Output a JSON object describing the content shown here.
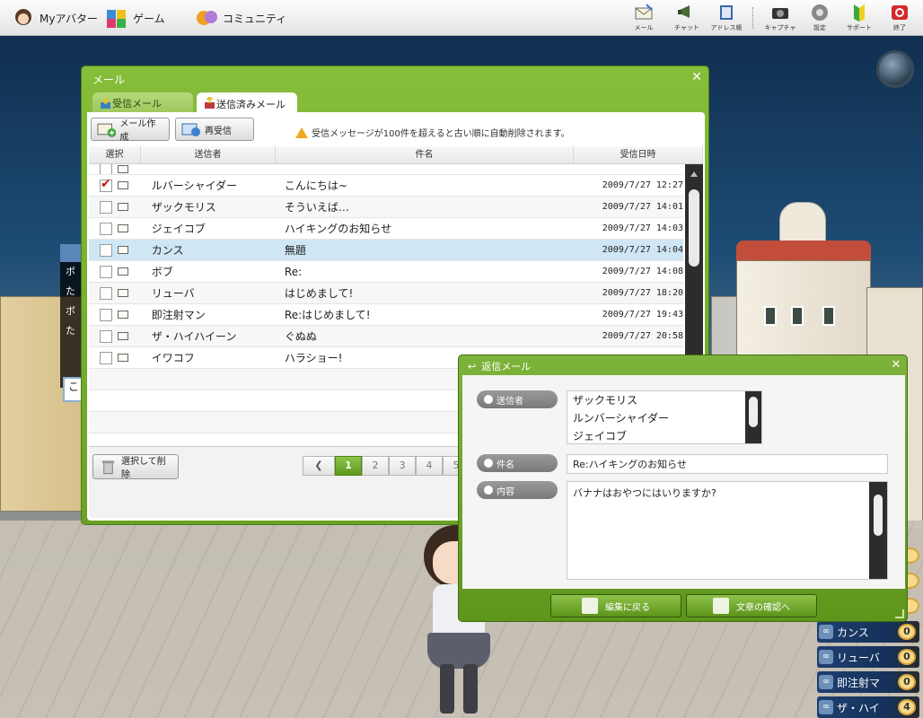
{
  "topbar": {
    "nav": [
      {
        "label": "Myアバター",
        "icon": "avatar-icon"
      },
      {
        "label": "ゲーム",
        "icon": "game-icon"
      },
      {
        "label": "コミュニティ",
        "icon": "community-icon"
      }
    ],
    "tools": [
      {
        "label": "メール",
        "icon": "mail-icon"
      },
      {
        "label": "チャット",
        "icon": "chat-icon"
      },
      {
        "label": "アドレス帳",
        "icon": "address-book-icon"
      },
      {
        "label": "キャプチャー",
        "icon": "camera-icon"
      },
      {
        "label": "設定",
        "icon": "settings-icon"
      },
      {
        "label": "サポート",
        "icon": "support-icon"
      },
      {
        "label": "終了",
        "icon": "power-icon"
      }
    ]
  },
  "mail": {
    "title": "メール",
    "tabs": [
      {
        "label": "受信メール"
      },
      {
        "label": "送信済みメール",
        "selected": true
      }
    ],
    "buttons": {
      "compose": "メール作成",
      "refresh": "再受信",
      "delete_selected": "選択して削除"
    },
    "notice": "受信メッセージが100件を超えると古い順に自動削除されます。",
    "columns": {
      "select": "選択",
      "sender": "送信者",
      "subject": "件名",
      "date": "受信日時"
    },
    "rows": [
      {
        "sender": "",
        "subject": "",
        "date": "",
        "checked": false,
        "opened": false
      },
      {
        "sender": "ルバーシャイダー",
        "subject": "こんにちは~",
        "date": "2009/7/27  12:27",
        "checked": true,
        "opened": false
      },
      {
        "sender": "ザックモリス",
        "subject": "そういえば…",
        "date": "2009/7/27  14:01",
        "checked": false,
        "opened": true
      },
      {
        "sender": "ジェイコブ",
        "subject": "ハイキングのお知らせ",
        "date": "2009/7/27  14:03",
        "checked": false,
        "opened": true
      },
      {
        "sender": "カンス",
        "subject": "無題",
        "date": "2009/7/27  14:04",
        "checked": false,
        "opened": true,
        "highlighted": true
      },
      {
        "sender": "ボブ",
        "subject": "Re:",
        "date": "2009/7/27  14:08",
        "checked": false,
        "opened": true
      },
      {
        "sender": "リューバ",
        "subject": "はじめまして!",
        "date": "2009/7/27  18:20",
        "checked": false,
        "opened": true
      },
      {
        "sender": "即注射マン",
        "subject": "Re:はじめまして!",
        "date": "2009/7/27  19:43",
        "checked": false,
        "opened": true
      },
      {
        "sender": "ザ・ハイハイーン",
        "subject": "ぐぬぬ",
        "date": "2009/7/27  20:58",
        "checked": false,
        "opened": true
      },
      {
        "sender": "イワコフ",
        "subject": "ハラショー!",
        "date": "",
        "checked": false,
        "opened": true
      }
    ],
    "pager": {
      "pages": [
        "1",
        "2",
        "3",
        "4",
        "5"
      ],
      "current": "1"
    }
  },
  "reply": {
    "title": "返信メール",
    "labels": {
      "sender": "送信者",
      "subject": "件名",
      "body": "内容"
    },
    "recipients": [
      "ザックモリス",
      "ルンバーシャイダー",
      "ジェイコブ"
    ],
    "subject": "Re:ハイキングのお知らせ",
    "body": "バナナはおやつにはいりますか?",
    "buttons": {
      "back": "編集に戻る",
      "confirm": "文章の確認へ"
    }
  },
  "chat_fragment": [
    "ボ",
    "た",
    "ボ",
    "た"
  ],
  "chat_input": "こ",
  "friends": [
    {
      "name": "カンス",
      "count": "0"
    },
    {
      "name": "リューバ",
      "count": "0"
    },
    {
      "name": "即注射マ",
      "count": "0"
    },
    {
      "name": "ザ・ハイ",
      "count": "4"
    }
  ],
  "colors": {
    "accent": "#6aa224",
    "accent_dark": "#4b7d16",
    "selected_row": "#cfe6f5",
    "check_red": "#c21818"
  }
}
